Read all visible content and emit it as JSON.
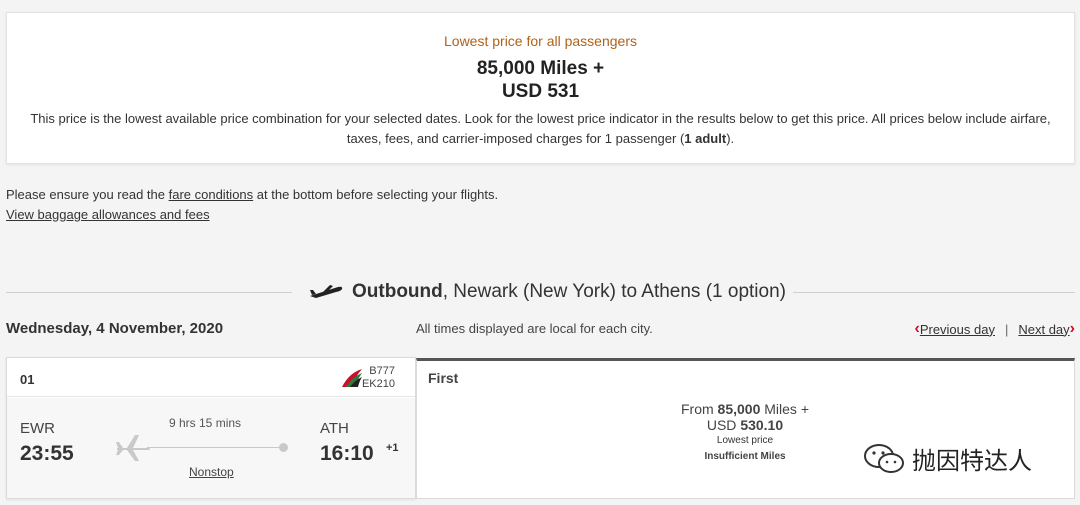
{
  "summary": {
    "heading": "Lowest price for all passengers",
    "miles": "85,000 Miles +",
    "usd": "USD 531",
    "description_pre": "This price is the lowest available price combination for your selected dates. Look for the lowest price indicator in the results below to get this price. All prices below include airfare, taxes, fees, and carrier-imposed charges for 1 passenger (",
    "description_bold": "1 adult",
    "description_post": ")."
  },
  "notice": {
    "pre": "Please ensure you read the ",
    "fare_link": "fare conditions",
    "post": " at the bottom before selecting your flights.",
    "baggage_link": "View baggage allowances and fees"
  },
  "outbound": {
    "label": "Outbound",
    "route": ", Newark (New York) to Athens (1 option)"
  },
  "date_row": {
    "date": "Wednesday, 4 November, 2020",
    "times_note": "All times displayed are local for each city.",
    "prev_day": "Previous day",
    "next_day": "Next day",
    "separator": "|"
  },
  "flight": {
    "number": "01",
    "aircraft": "B777",
    "code": "EK210",
    "departure_code": "EWR",
    "departure_time": "23:55",
    "duration": "9 hrs 15 mins",
    "stops": "Nonstop",
    "arrival_code": "ATH",
    "arrival_time": "16:10",
    "day_offset": "+1"
  },
  "fare": {
    "cabin": "First",
    "from": "From ",
    "miles": "85,000",
    "miles_suffix": " Miles +",
    "usd_prefix": "USD ",
    "usd": "530.10",
    "lowest_tag": "Lowest price",
    "status": "Insufficient Miles"
  },
  "watermark": {
    "text": "抛因特达人"
  },
  "colors": {
    "accent_orange": "#b0621a",
    "nav_red": "#c8102e"
  },
  "icons": [
    "airplane-takeoff-icon",
    "chevron-left-icon",
    "chevron-right-icon",
    "airline-logo-icon",
    "airplane-path-icon",
    "wechat-icon"
  ]
}
